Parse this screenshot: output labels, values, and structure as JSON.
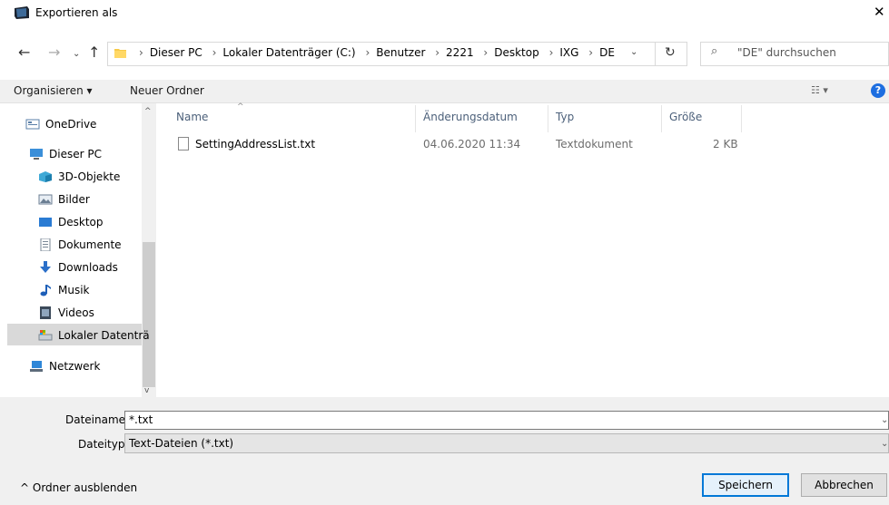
{
  "window": {
    "title": "Exportieren als",
    "close_glyph": "✕"
  },
  "nav_buttons": {
    "back": "←",
    "forward": "→",
    "recent": "⌄",
    "up": "↑"
  },
  "breadcrumb": [
    "Dieser PC",
    "Lokaler Datenträger (C:)",
    "Benutzer",
    "2221",
    "Desktop",
    "IXG",
    "DE"
  ],
  "breadcrumb_sep": "›",
  "address": {
    "dropdown": "⌄",
    "refresh": "↻"
  },
  "search": {
    "placeholder": "\"DE\" durchsuchen",
    "icon": "⌕"
  },
  "toolbar": {
    "organize": "Organisieren ▾",
    "new_folder": "Neuer Ordner",
    "view": "☷ ▾",
    "help": "?"
  },
  "sidebar": {
    "items": [
      {
        "label": "OneDrive",
        "icon": "onedrive-icon"
      },
      {
        "label": "Dieser PC",
        "icon": "computer-icon"
      },
      {
        "label": "3D-Objekte",
        "icon": "3d-objects-icon"
      },
      {
        "label": "Bilder",
        "icon": "pictures-icon"
      },
      {
        "label": "Desktop",
        "icon": "desktop-icon"
      },
      {
        "label": "Dokumente",
        "icon": "documents-icon"
      },
      {
        "label": "Downloads",
        "icon": "downloads-icon"
      },
      {
        "label": "Musik",
        "icon": "music-icon"
      },
      {
        "label": "Videos",
        "icon": "videos-icon"
      },
      {
        "label": "Lokaler Datenträ",
        "icon": "drive-icon"
      },
      {
        "label": "Netzwerk",
        "icon": "network-icon"
      }
    ],
    "scroll_up": "^",
    "scroll_down": "v"
  },
  "columns": {
    "name": "Name",
    "date": "Änderungsdatum",
    "type": "Typ",
    "size": "Größe",
    "sort_indicator": "^"
  },
  "files": [
    {
      "name": "SettingAddressList.txt",
      "date": "04.06.2020 11:34",
      "type": "Textdokument",
      "size": "2 KB"
    }
  ],
  "form": {
    "filename_label": "Dateiname:",
    "filename_value": "*.txt",
    "filetype_label": "Dateityp:",
    "filetype_value": "Text-Dateien (*.txt)",
    "dropdown_arrow": "⌄"
  },
  "footer": {
    "hide_folders": "^ Ordner ausblenden",
    "save": "Speichern",
    "cancel": "Abbrechen"
  },
  "colors": {
    "accent": "#0078d7",
    "help": "#1d6ee0",
    "column_header": "#4c607a"
  }
}
